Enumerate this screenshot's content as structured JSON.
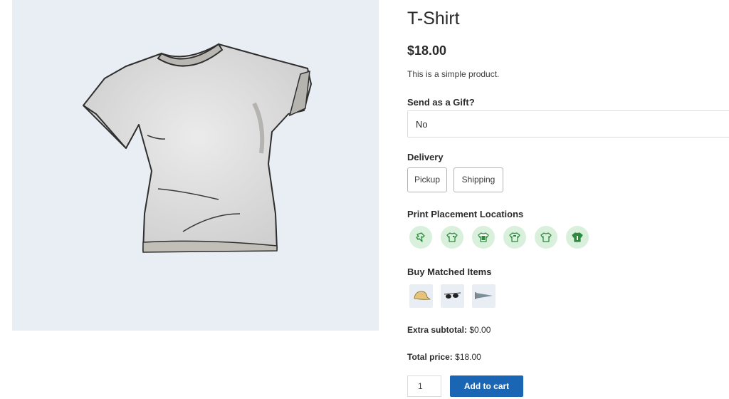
{
  "product": {
    "title": "T-Shirt",
    "price": "$18.00",
    "description": "This is a simple product."
  },
  "gift": {
    "label": "Send as a Gift?",
    "selected": "No"
  },
  "delivery": {
    "label": "Delivery",
    "options": [
      "Pickup",
      "Shipping"
    ]
  },
  "print_placement": {
    "label": "Print Placement Locations",
    "icons": [
      "sleeve-print-icon",
      "front-chest-print-icon",
      "full-front-print-icon",
      "back-print-icon",
      "small-front-print-icon",
      "full-back-print-icon"
    ]
  },
  "matched_items": {
    "label": "Buy Matched Items",
    "items": [
      "cap-icon",
      "sunglasses-icon",
      "pennant-icon"
    ]
  },
  "totals": {
    "extra_label": "Extra subtotal:",
    "extra_value": "$0.00",
    "total_label": "Total price:",
    "total_value": "$18.00"
  },
  "cart": {
    "quantity": "1",
    "add_label": "Add to cart"
  },
  "colors": {
    "accent": "#1b65b5",
    "swatch_bg": "#d9f0dc",
    "swatch_icon": "#2e8a3e",
    "gallery_bg": "#e8eef3"
  }
}
